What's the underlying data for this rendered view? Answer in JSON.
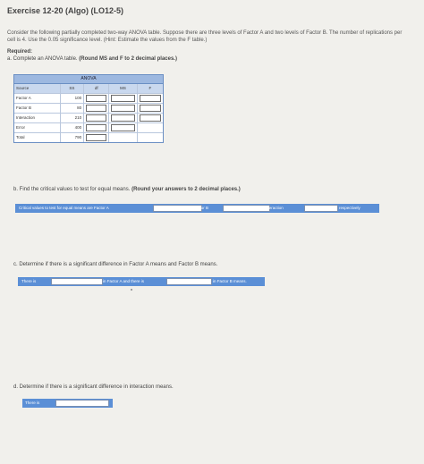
{
  "header": {
    "title": "Exercise 12-20 (Algo) (LO12-5)"
  },
  "intro": "Consider the following partially completed two-way ANOVA table. Suppose there are three levels of Factor A and two levels of Factor B. The number of replications per cell is 4. Use the 0.05 significance level. (Hint: Estimate the values from the F table.)",
  "required": {
    "heading": "Required:",
    "part_a": "a. Complete an ANOVA table.",
    "part_a_bold": "(Round MS and F to 2 decimal places.)"
  },
  "anova": {
    "title": "ANOVA",
    "columns": [
      "Source",
      "SS",
      "df",
      "MS",
      "F"
    ],
    "rows": [
      {
        "source": "Factor A",
        "ss": "100"
      },
      {
        "source": "Factor B",
        "ss": "80"
      },
      {
        "source": "Interaction",
        "ss": "210"
      },
      {
        "source": "Error",
        "ss": "400"
      },
      {
        "source": "Total",
        "ss": "790"
      }
    ]
  },
  "part_b": {
    "prompt": "b. Find the critical values to test for equal means.",
    "prompt_bold": "(Round your answers to 2 decimal places.)",
    "bar": {
      "label1": "Critical values to test for equal means are Factor A",
      "label2": "Factor B",
      "label3": "and Interaction",
      "label4": "respectively"
    }
  },
  "part_c": {
    "prompt": "c. Determine if there is a significant difference in Factor A means and Factor B means.",
    "bar": {
      "label1": "There is",
      "label2": "in Factor A and there is",
      "label3": "in Factor B means."
    }
  },
  "part_d": {
    "prompt": "d. Determine if there is a significant difference in interaction means.",
    "bar": {
      "label1": "There is"
    }
  },
  "colors": {
    "bar": "#5b8fd6",
    "table_header": "#9db8e0",
    "background": "#f1f0ec"
  }
}
